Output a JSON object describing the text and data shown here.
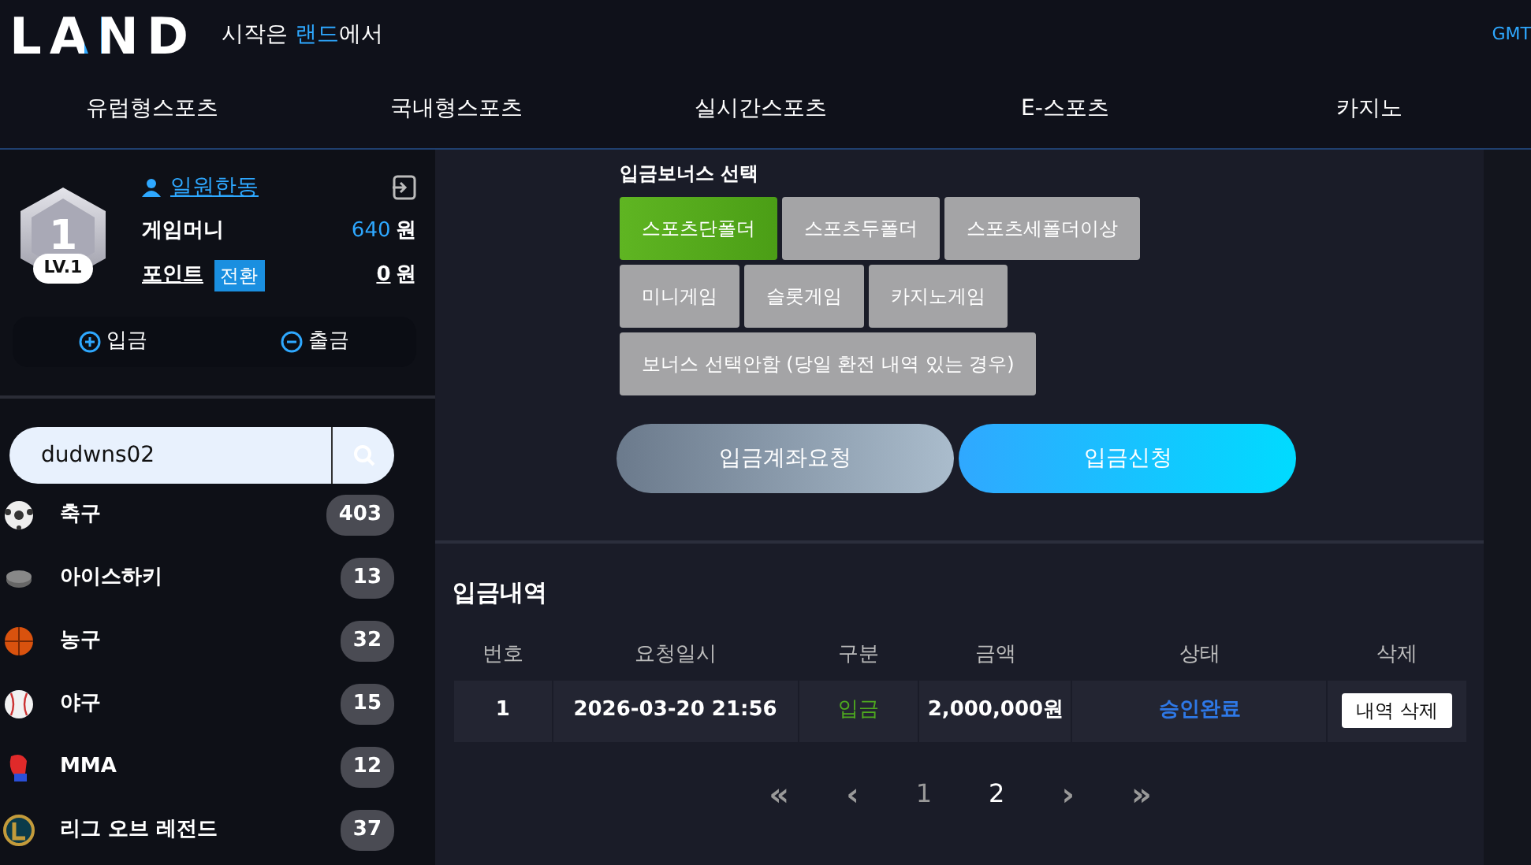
{
  "header": {
    "logo": "LAND",
    "tagline": {
      "before": "시작은 ",
      "highlight": "랜드",
      "after": "에서"
    },
    "timezone": "GMT"
  },
  "nav": [
    {
      "label": "유럽형스포츠"
    },
    {
      "label": "국내형스포츠"
    },
    {
      "label": "실시간스포츠"
    },
    {
      "label": "E-스포츠"
    },
    {
      "label": "카지노"
    }
  ],
  "user": {
    "level_number": "1",
    "level_label": "LV.1",
    "name": "일원한동",
    "game_money_label": "게임머니",
    "game_money": "640",
    "game_money_unit": "원",
    "points_label": "포인트",
    "convert": "전환",
    "points": "0",
    "points_unit": "원",
    "deposit": "입금",
    "withdraw": "출금"
  },
  "search": {
    "value": "dudwns02"
  },
  "sports": [
    {
      "name": "축구",
      "count": "403"
    },
    {
      "name": "아이스하키",
      "count": "13"
    },
    {
      "name": "농구",
      "count": "32"
    },
    {
      "name": "야구",
      "count": "15"
    },
    {
      "name": "MMA",
      "count": "12"
    },
    {
      "name": "리그 오브 레전드",
      "count": "37"
    }
  ],
  "bonus": {
    "title": "입금보너스 선택",
    "option_rows": [
      [
        {
          "label": "스포츠단폴더",
          "selected": true
        },
        {
          "label": "스포츠두폴더",
          "selected": false
        },
        {
          "label": "스포츠세폴더이상",
          "selected": false
        }
      ],
      [
        {
          "label": "미니게임",
          "selected": false
        },
        {
          "label": "슬롯게임",
          "selected": false
        },
        {
          "label": "카지노게임",
          "selected": false
        }
      ],
      [
        {
          "label": "보너스 선택안함 (당일 환전 내역 있는 경우)",
          "selected": false
        }
      ]
    ]
  },
  "actions": [
    {
      "label": "입금계좌요청",
      "kind": "secondary"
    },
    {
      "label": "입금신청",
      "kind": "primary"
    }
  ],
  "history": {
    "title": "입금내역",
    "columns": [
      "번호",
      "요청일시",
      "구분",
      "금액",
      "상태",
      "삭제"
    ],
    "rows": [
      {
        "number": "1",
        "datetime": "2026-03-20 21:56",
        "type": "입금",
        "amount": "2,000,000원",
        "status": "승인완료",
        "action": "내역 삭제"
      }
    ]
  },
  "pagination": [
    {
      "label": "«",
      "kind": "first",
      "selected": false
    },
    {
      "label": "‹",
      "kind": "prev",
      "selected": false
    },
    {
      "label": "1",
      "kind": "page",
      "selected": false
    },
    {
      "label": "2",
      "kind": "page",
      "selected": true
    },
    {
      "label": "›",
      "kind": "next",
      "selected": false
    },
    {
      "label": "»",
      "kind": "last",
      "selected": false
    }
  ]
}
